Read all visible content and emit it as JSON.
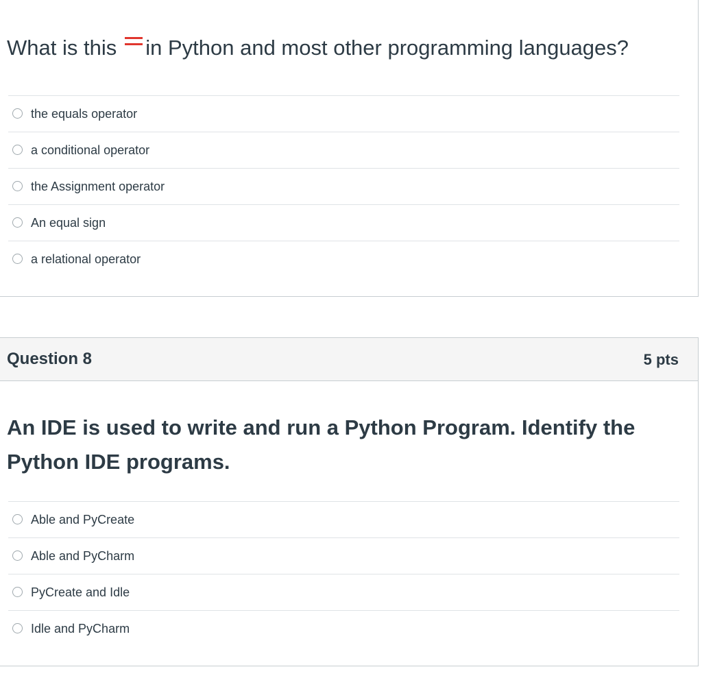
{
  "question7": {
    "text_before": "What is this",
    "symbol": "=",
    "text_after": "in Python and most other programming languages?",
    "symbol_color": "#e0362e",
    "answers": [
      "the equals operator",
      "a conditional operator",
      "the Assignment operator",
      "An equal sign",
      "a relational operator"
    ]
  },
  "question8": {
    "title": "Question 8",
    "points": "5 pts",
    "text": "An IDE is used to write and run a Python Program.  Identify the Python IDE programs.",
    "answers": [
      "Able and PyCreate",
      "Able and PyCharm",
      "PyCreate and Idle",
      "Idle and PyCharm"
    ]
  },
  "colors": {
    "text": "#2d3b45",
    "header_bg": "#f5f5f5",
    "border": "#c7cdd1",
    "divider": "#dfe3e6"
  }
}
